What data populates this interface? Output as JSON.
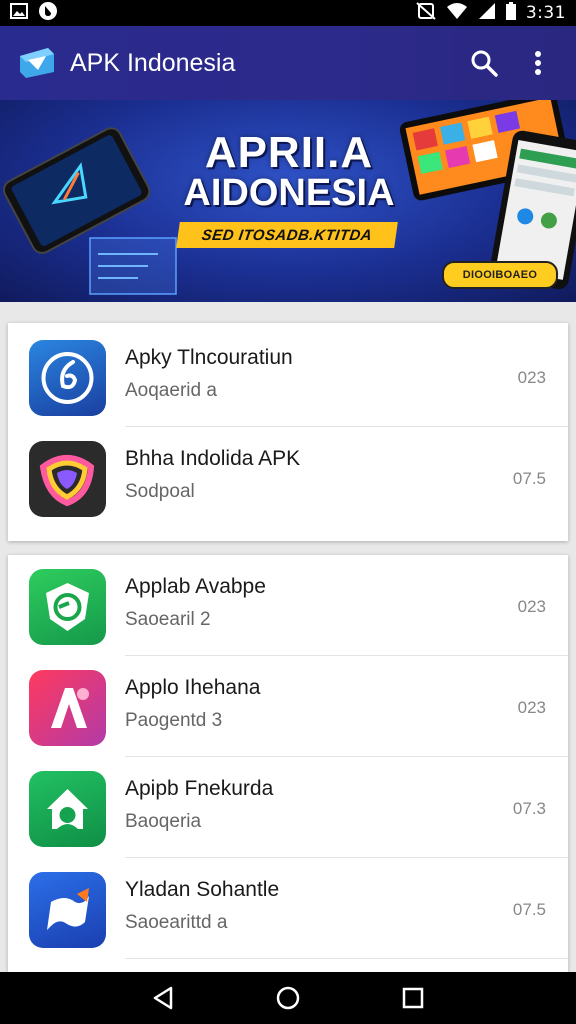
{
  "status_bar": {
    "time": "3:31",
    "icons": [
      "image-icon",
      "notification-icon",
      "no-nfc-icon",
      "wifi-icon",
      "signal-icon",
      "battery-icon"
    ]
  },
  "app_bar": {
    "title": "APK Indonesia",
    "actions": [
      "search-icon",
      "more-vert-icon"
    ]
  },
  "banner": {
    "line1": "APRII.A",
    "line2": "AIDONESIA",
    "ribbon": "SED ITOSADB.KTITDA",
    "pill": "DIOOIBOAEO"
  },
  "lists": [
    {
      "items": [
        {
          "name": "Apky Tlncouratiun",
          "subtitle": "Aoqaerid a",
          "version": "023",
          "icon": "compass-icon",
          "color": "#1e4fb8"
        },
        {
          "name": "Bhha Indolida APK",
          "subtitle": "Sodpoal",
          "version": "07.5",
          "icon": "colorful-shield-icon",
          "color": "#2a2a2a"
        }
      ]
    },
    {
      "items": [
        {
          "name": "Applab Avabpe",
          "subtitle": "Saoearil 2",
          "version": "023",
          "icon": "green-shield-icon",
          "color": "#1aa64a"
        },
        {
          "name": "Applo Ihehana",
          "subtitle": "Paogentd 3",
          "version": "023",
          "icon": "letter-a-icon",
          "color": "#d8306e"
        },
        {
          "name": "Apipb Fnekurda",
          "subtitle": "Baoqeria",
          "version": "07.3",
          "icon": "green-house-icon",
          "color": "#16a34f"
        },
        {
          "name": "Yladan Sohantle",
          "subtitle": "Saoearittd a",
          "version": "07.5",
          "icon": "flag-icon",
          "color": "#1f4fc4"
        }
      ]
    }
  ],
  "nav_bar": [
    "back-icon",
    "home-icon",
    "recents-icon"
  ]
}
